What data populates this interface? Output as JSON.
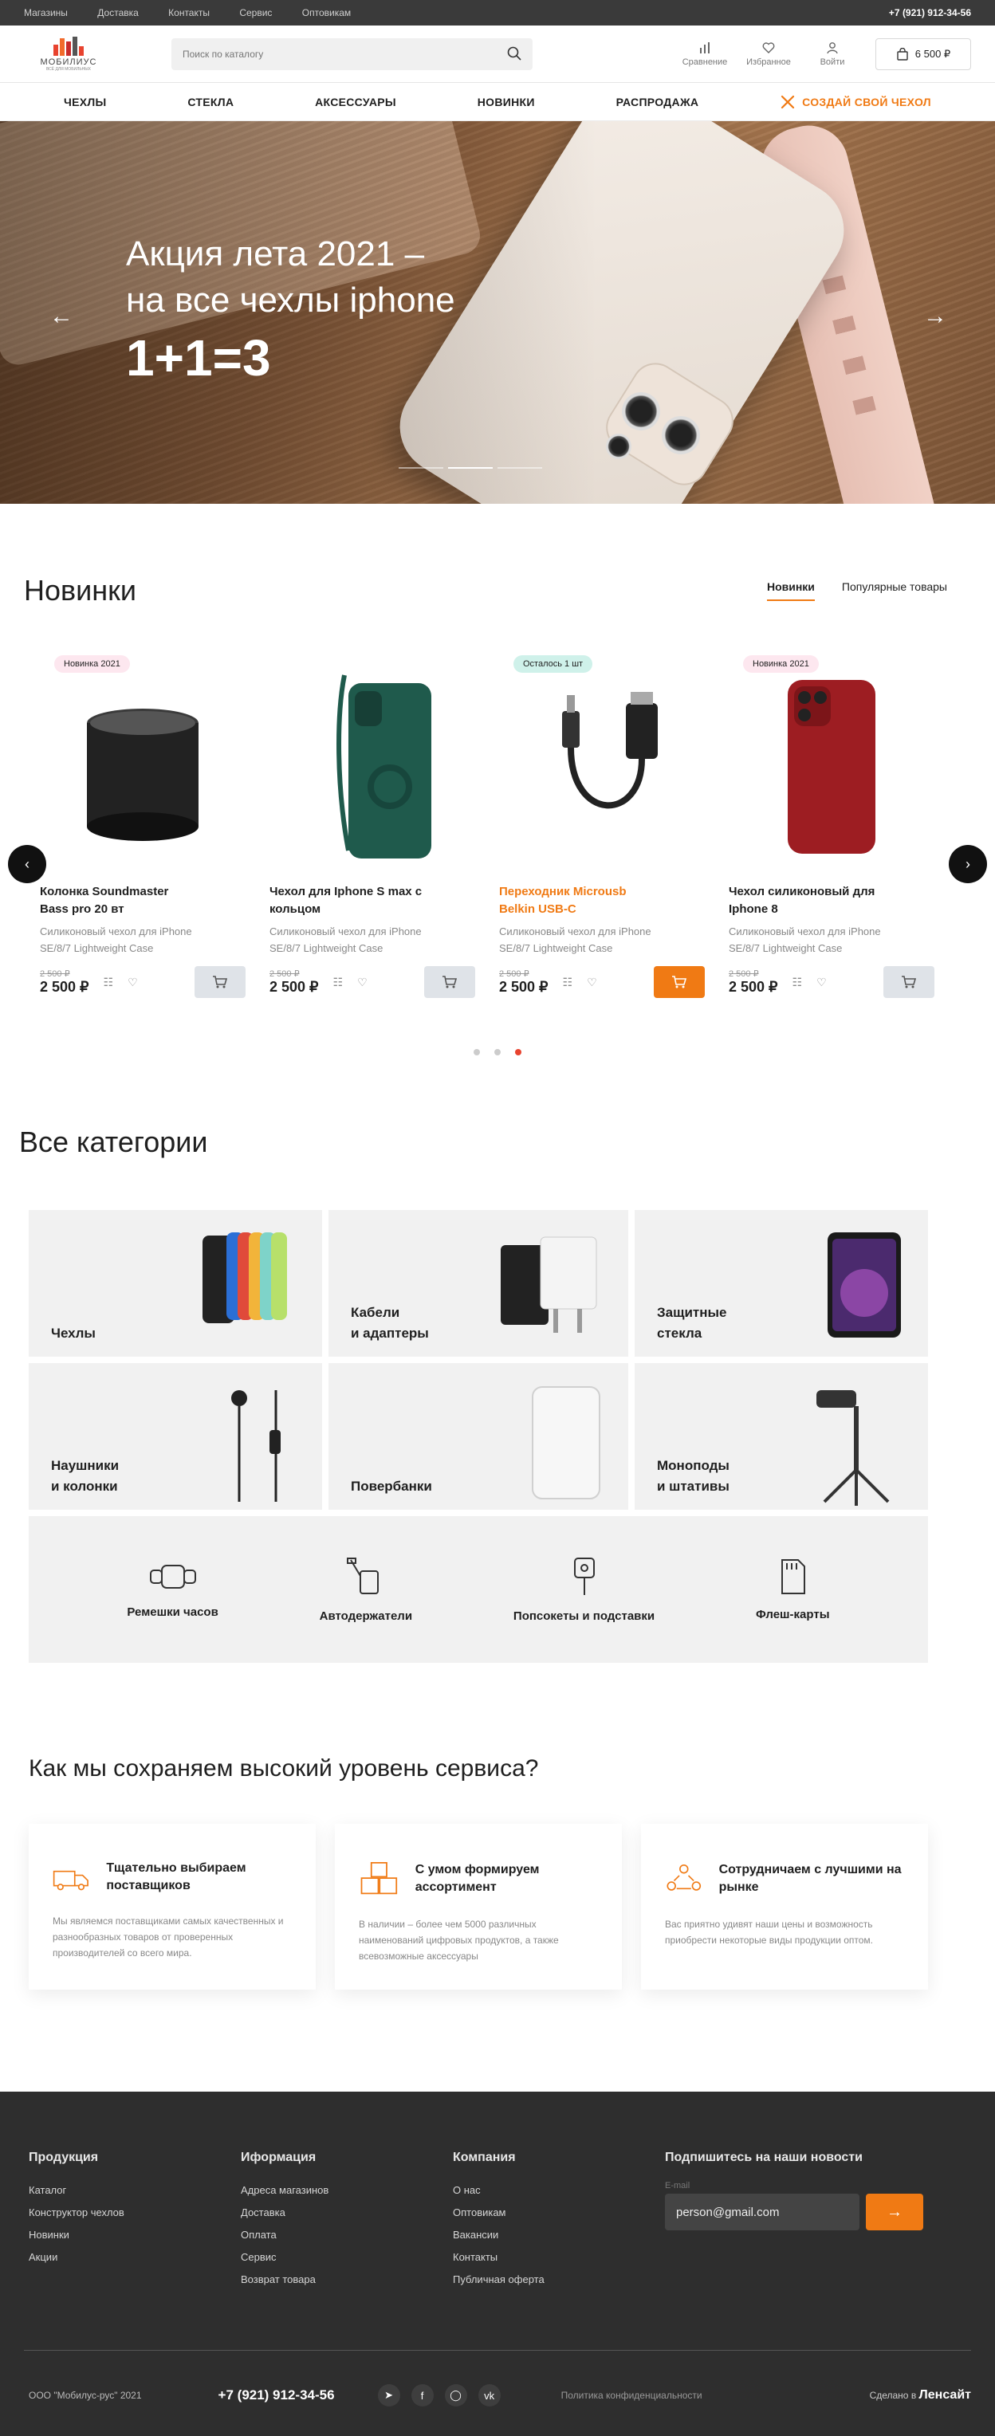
{
  "topbar": {
    "links": [
      "Магазины",
      "Доставка",
      "Контакты",
      "Сервис",
      "Оптовикам"
    ],
    "phone": "+7 (921) 912-34-56"
  },
  "header": {
    "logo_word": "МОБИЛИУС",
    "logo_tag": "ВСЁ ДЛЯ МОБИЛЬНЫХ",
    "search_placeholder": "Поиск по каталогу",
    "compare": "Сравнение",
    "favorites": "Избранное",
    "login": "Войти",
    "cart_total": "6 500 ₽"
  },
  "nav": {
    "items": [
      "ЧЕХЛЫ",
      "СТЕКЛА",
      "АКСЕССУАРЫ",
      "НОВИНКИ",
      "РАСПРОДАЖА"
    ],
    "create": "СОЗДАЙ СВОЙ ЧЕХОЛ"
  },
  "hero": {
    "line1": "Акция лета 2021 –",
    "line2": "на все чехлы iphone",
    "big": "1+1=3",
    "slide_count": 3,
    "active_slide": 2
  },
  "new_section": {
    "title": "Новинки",
    "tabs": [
      "Новинки",
      "Популярные товары"
    ],
    "active_tab": 0,
    "products": [
      {
        "badge": "Новинка 2021",
        "title": "Колонка Soundmaster Bass pro 20 вт",
        "desc": "Силиконовый чехол для iPhone SE/8/7 Lightweight Case",
        "old": "2 500 ₽",
        "price": "2 500 ₽",
        "accent": false
      },
      {
        "badge": "",
        "title": "Чехол для Iphone S max с кольцом",
        "desc": "Силиконовый чехол для iPhone SE/8/7 Lightweight Case",
        "old": "2 500 ₽",
        "price": "2 500 ₽",
        "accent": false
      },
      {
        "badge": "Осталось 1 шт",
        "title": "Переходник Microusb Belkin USB-C",
        "desc": "Силиконовый чехол для iPhone SE/8/7 Lightweight Case",
        "old": "2 500 ₽",
        "price": "2 500 ₽",
        "accent": true
      },
      {
        "badge": "Новинка 2021",
        "title": "Чехол силиконовый для Iphone 8",
        "desc": "Силиконовый чехол для iPhone SE/8/7 Lightweight Case",
        "old": "2 500 ₽",
        "price": "2 500 ₽",
        "accent": false
      }
    ],
    "page_count": 3,
    "active_page": 2
  },
  "categories": {
    "title": "Все категории",
    "boxes": [
      "Чехлы",
      "Кабели\nи адаптеры",
      "Защитные\nстекла",
      "Наушники\nи колонки",
      "Повербанки",
      "Монoподы\nи штативы"
    ],
    "small": [
      "Ремешки часов",
      "Автодержатели",
      "Попсокеты и подставки",
      "Флеш-карты"
    ]
  },
  "service": {
    "title": "Как мы сохраняем высокий уровень сервиса?",
    "cards": [
      {
        "title": "Тщательно выбираем поставщиков",
        "text": "Мы являемся поставщиками самых качественных и разнообразных товаров от проверенных производителей со всего мира."
      },
      {
        "title": "С умом формируем ассортимент",
        "text": "В наличии – более чем 5000 различных наименований цифровых продуктов, а также всевозможные аксессуары"
      },
      {
        "title": "Сотрудничаем с лучшими на рынке",
        "text": "Вас приятно удивят наши цены и возможность приобрести некоторые виды продукции оптом."
      }
    ]
  },
  "footer": {
    "cols": [
      {
        "title": "Продукция",
        "links": [
          "Каталог",
          "Конструктор чехлов",
          "Новинки",
          "Акции"
        ]
      },
      {
        "title": "Иформация",
        "links": [
          "Адреса магазинов",
          "Доставка",
          "Оплата",
          "Сервис",
          "Возврат товара"
        ]
      },
      {
        "title": "Компания",
        "links": [
          "О нас",
          "Оптовикам",
          "Вакансии",
          "Контакты",
          "Публичная оферта"
        ]
      }
    ],
    "subscribe_title": "Подпишитесь на наши новости",
    "email_label": "E-mail",
    "email_value": "person@gmail.com",
    "copyright": "ООО \"Мобилус-рус\" 2021",
    "phone": "+7 (921) 912-34-56",
    "policy": "Политика конфиденциальности",
    "made_by": "Сделано в",
    "studio": "Ленсайт"
  },
  "colors": {
    "accent": "#f07a14",
    "dark": "#2e2e2e",
    "topbar": "#3a3a3a",
    "badge_new": "#fde7ef",
    "badge_left": "#cff1ea"
  }
}
